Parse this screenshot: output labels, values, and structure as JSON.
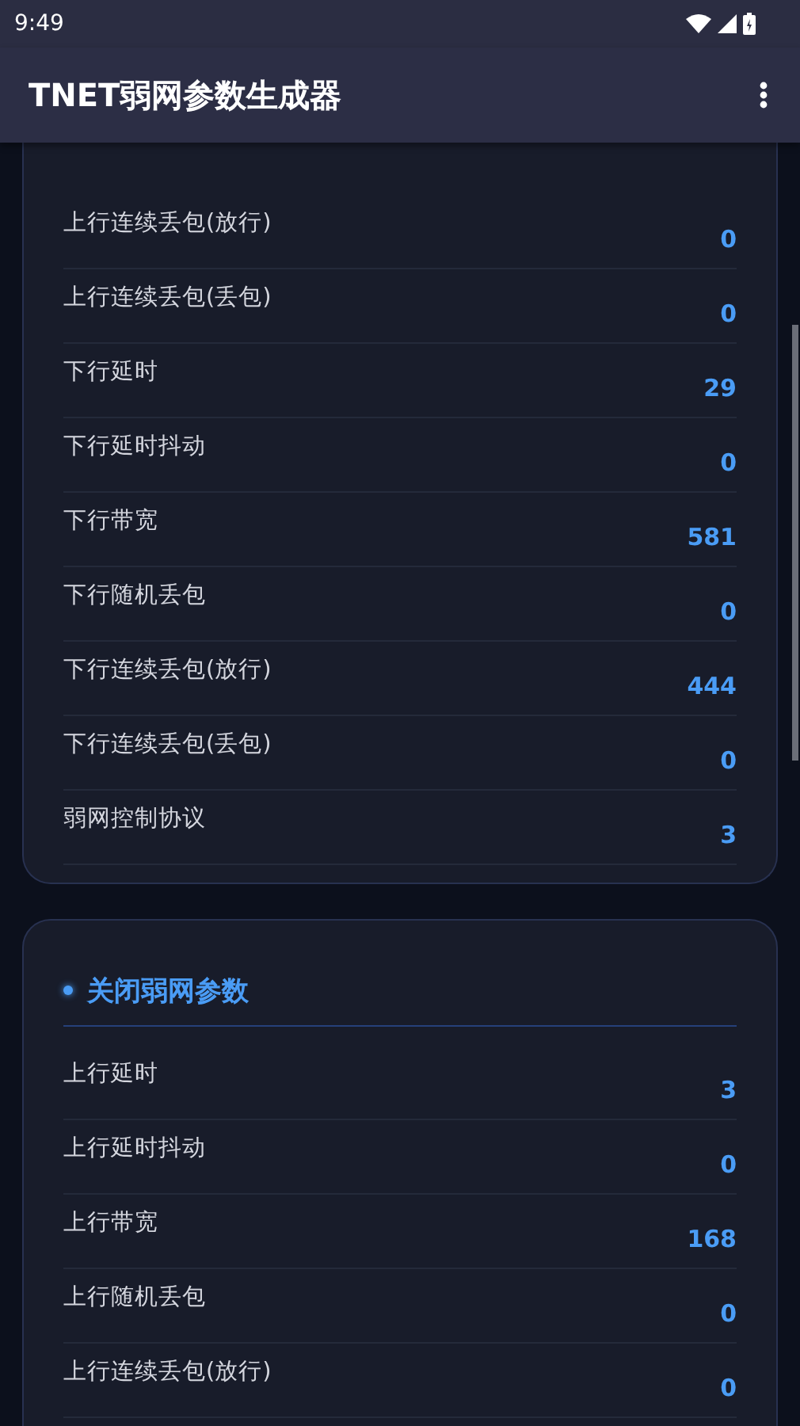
{
  "status_bar": {
    "time": "9:49"
  },
  "app_bar": {
    "title": "TNET弱网参数生成器"
  },
  "sections": [
    {
      "rows": [
        {
          "label": "上行连续丢包(放行)",
          "value": "0"
        },
        {
          "label": "上行连续丢包(丢包)",
          "value": "0"
        },
        {
          "label": "下行延时",
          "value": "29"
        },
        {
          "label": "下行延时抖动",
          "value": "0"
        },
        {
          "label": "下行带宽",
          "value": "581"
        },
        {
          "label": "下行随机丢包",
          "value": "0"
        },
        {
          "label": "下行连续丢包(放行)",
          "value": "444"
        },
        {
          "label": "下行连续丢包(丢包)",
          "value": "0"
        },
        {
          "label": "弱网控制协议",
          "value": "3"
        }
      ]
    },
    {
      "title": "关闭弱网参数",
      "rows": [
        {
          "label": "上行延时",
          "value": "3"
        },
        {
          "label": "上行延时抖动",
          "value": "0"
        },
        {
          "label": "上行带宽",
          "value": "168"
        },
        {
          "label": "上行随机丢包",
          "value": "0"
        },
        {
          "label": "上行连续丢包(放行)",
          "value": "0"
        }
      ]
    }
  ]
}
